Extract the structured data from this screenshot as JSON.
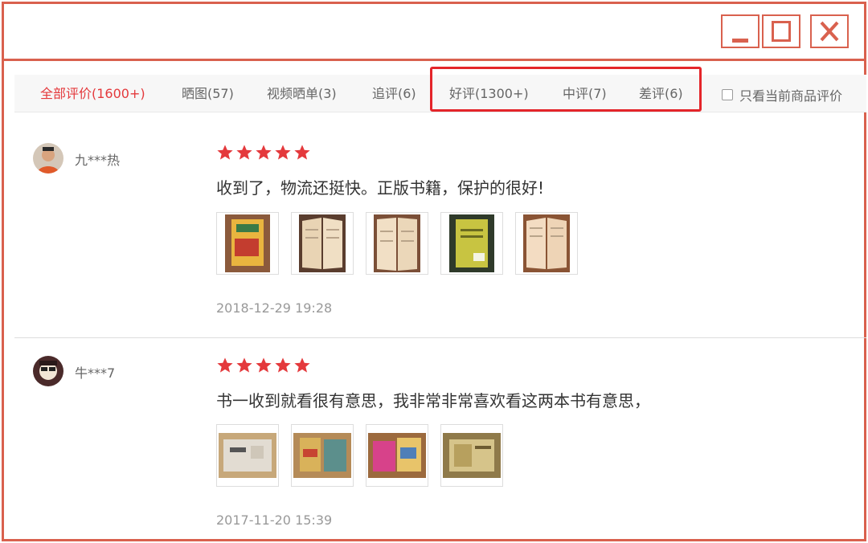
{
  "tabs": [
    {
      "label": "全部评价(1600+)",
      "active": true
    },
    {
      "label": "晒图(57)",
      "active": false
    },
    {
      "label": "视频晒单(3)",
      "active": false
    },
    {
      "label": "追评(6)",
      "active": false
    },
    {
      "label": "好评(1300+)",
      "active": false
    },
    {
      "label": "中评(7)",
      "active": false
    },
    {
      "label": "差评(6)",
      "active": false
    }
  ],
  "filter": {
    "only_current_label": "只看当前商品评价",
    "checked": false
  },
  "reviews": [
    {
      "username": "九***热",
      "stars": 5,
      "comment": "收到了，物流还挺快。正版书籍，保护的很好!",
      "photo_count": 5,
      "date": "2018-12-29 19:28"
    },
    {
      "username": "牛***7",
      "stars": 5,
      "comment": "书一收到就看很有意思，我非常非常喜欢看这两本书有意思，",
      "photo_count": 4,
      "date": "2017-11-20 15:39"
    }
  ],
  "colors": {
    "frame": "#d9614e",
    "active_tab": "#e4393c",
    "highlight_box": "#e4252a",
    "star": "#e4393c"
  },
  "icons": [
    "minimize-icon",
    "maximize-icon",
    "close-icon",
    "star-icon"
  ]
}
